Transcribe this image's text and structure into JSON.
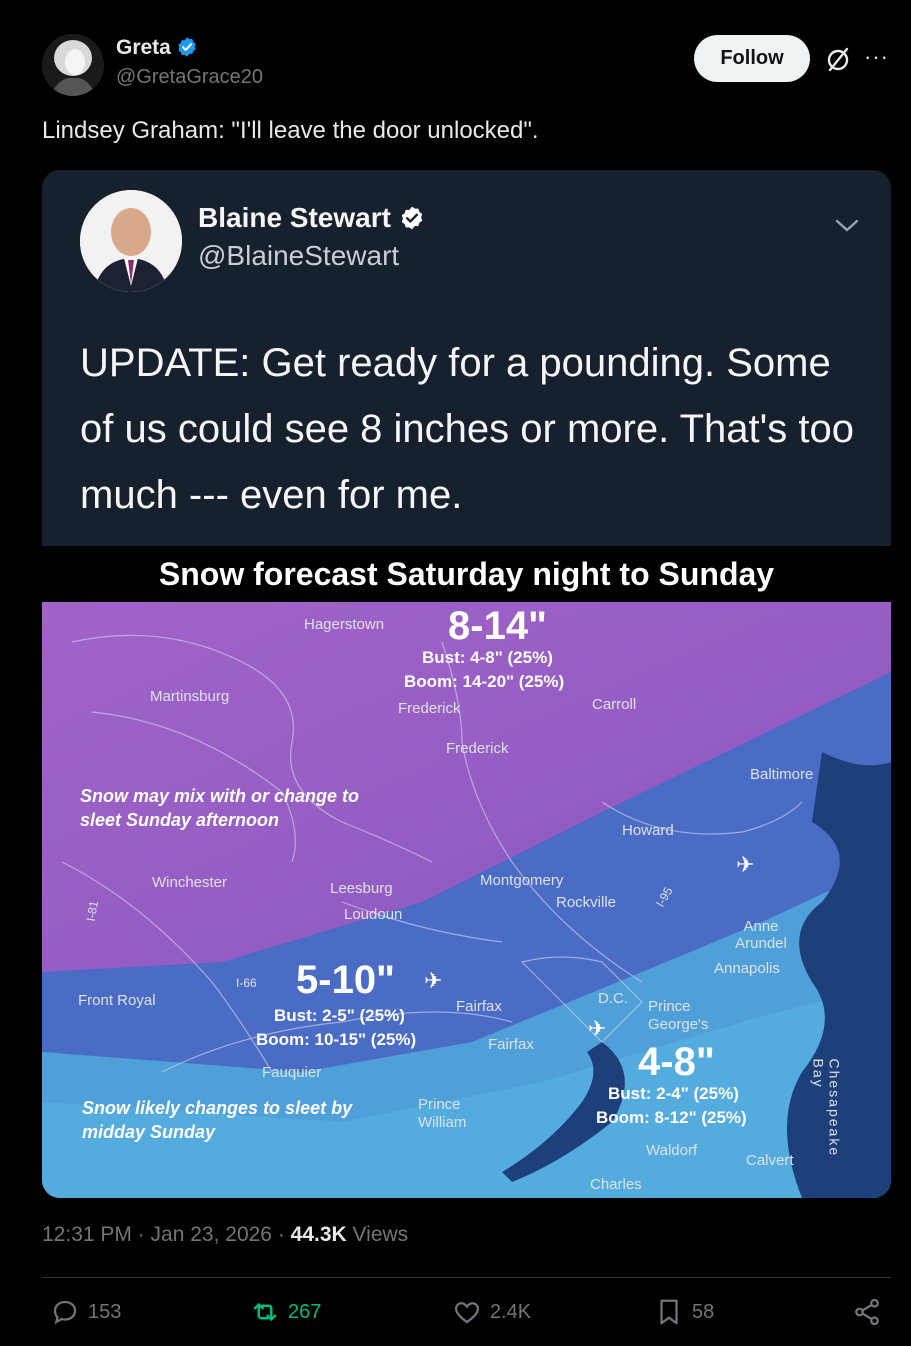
{
  "tweet": {
    "author_name": "Greta",
    "author_handle": "@GretaGrace20",
    "follow_label": "Follow",
    "more_label": "···",
    "text": "Lindsey Graham: \"I'll leave the door unlocked\".",
    "timestamp": "12:31 PM · Jan 23, 2026 · ",
    "views_count": "44.3K",
    "views_label": " Views"
  },
  "quoted": {
    "author_name": "Blaine Stewart",
    "author_handle": "@BlaineStewart",
    "text": "UPDATE: Get ready for a pounding. Some of us could see 8 inches or more. That's too much --- even for me."
  },
  "map": {
    "title": "Snow forecast Saturday night to Sunday",
    "cities": {
      "hagerstown": "Hagerstown",
      "martinsburg": "Martinsburg",
      "frederick1": "Frederick",
      "frederick2": "Frederick",
      "carroll": "Carroll",
      "baltimore": "Baltimore",
      "howard": "Howard",
      "winchester": "Winchester",
      "leesburg": "Leesburg",
      "loudoun": "Loudoun",
      "montgomery": "Montgomery",
      "rockville": "Rockville",
      "anne_arundel": "Anne Arundel",
      "annapolis": "Annapolis",
      "front_royal": "Front Royal",
      "fairfax1": "Fairfax",
      "fairfax2": "Fairfax",
      "dc": "D.C.",
      "prince_georges": "Prince George's",
      "fauquier": "Fauquier",
      "prince_william": "Prince William",
      "waldorf": "Waldorf",
      "calvert": "Calvert",
      "charles": "Charles",
      "chesapeake": "Chesapeake Bay",
      "i81": "I-81",
      "i66": "I-66",
      "i95": "I-95"
    },
    "zones": {
      "north_range": "8-14\"",
      "north_bust": "Bust: 4-8\" (25%)",
      "north_boom": "Boom: 14-20\" (25%)",
      "mid_range": "5-10\"",
      "mid_bust": "Bust: 2-5\" (25%)",
      "mid_boom": "Boom: 10-15\" (25%)",
      "south_range": "4-8\"",
      "south_bust": "Bust: 2-4\" (25%)",
      "south_boom": "Boom: 8-12\" (25%)"
    },
    "notes": {
      "mix": "Snow may mix with or change to sleet Sunday afternoon",
      "sleet": "Snow likely changes to sleet by midday Sunday"
    }
  },
  "actions": {
    "replies": "153",
    "reposts": "267",
    "likes": "2.4K",
    "bookmarks": "58"
  },
  "colors": {
    "verified": "#1d9bf0",
    "repost_active": "#00ba7c",
    "zone_north": "#9b5fc6",
    "zone_mid": "#4a6cc4",
    "zone_south": "#4fb7dd"
  }
}
